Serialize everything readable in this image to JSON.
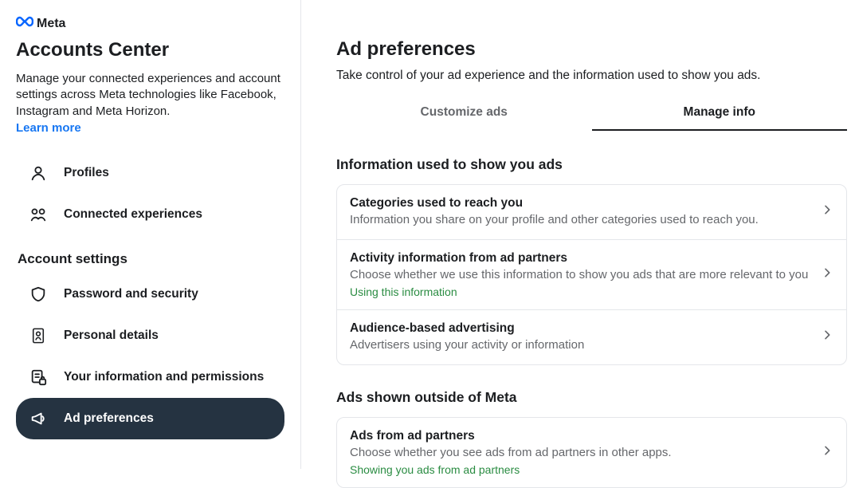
{
  "brand": "Meta",
  "sidebar": {
    "title": "Accounts Center",
    "description": "Manage your connected experiences and account settings across Meta technologies like Facebook, Instagram and Meta Horizon.",
    "learn_more": "Learn more",
    "top_items": [
      {
        "label": "Profiles",
        "icon": "profile-icon"
      },
      {
        "label": "Connected experiences",
        "icon": "connected-icon"
      }
    ],
    "section_label": "Account settings",
    "settings_items": [
      {
        "label": "Password and security",
        "icon": "shield-icon"
      },
      {
        "label": "Personal details",
        "icon": "id-card-icon"
      },
      {
        "label": "Your information and permissions",
        "icon": "doc-lock-icon"
      },
      {
        "label": "Ad preferences",
        "icon": "megaphone-icon"
      }
    ]
  },
  "main": {
    "title": "Ad preferences",
    "subtitle": "Take control of your ad experience and the information used to show you ads.",
    "tabs": [
      {
        "label": "Customize ads",
        "active": false
      },
      {
        "label": "Manage info",
        "active": true
      }
    ],
    "groups": [
      {
        "label": "Information used to show you ads",
        "rows": [
          {
            "title": "Categories used to reach you",
            "desc": "Information you share on your profile and other categories used to reach you.",
            "status": ""
          },
          {
            "title": "Activity information from ad partners",
            "desc": "Choose whether we use this information to show you ads that are more relevant to you",
            "status": "Using this information"
          },
          {
            "title": "Audience-based advertising",
            "desc": "Advertisers using your activity or information",
            "status": ""
          }
        ]
      },
      {
        "label": "Ads shown outside of Meta",
        "rows": [
          {
            "title": "Ads from ad partners",
            "desc": "Choose whether you see ads from ad partners in other apps.",
            "status": "Showing you ads from ad partners"
          }
        ]
      }
    ]
  }
}
